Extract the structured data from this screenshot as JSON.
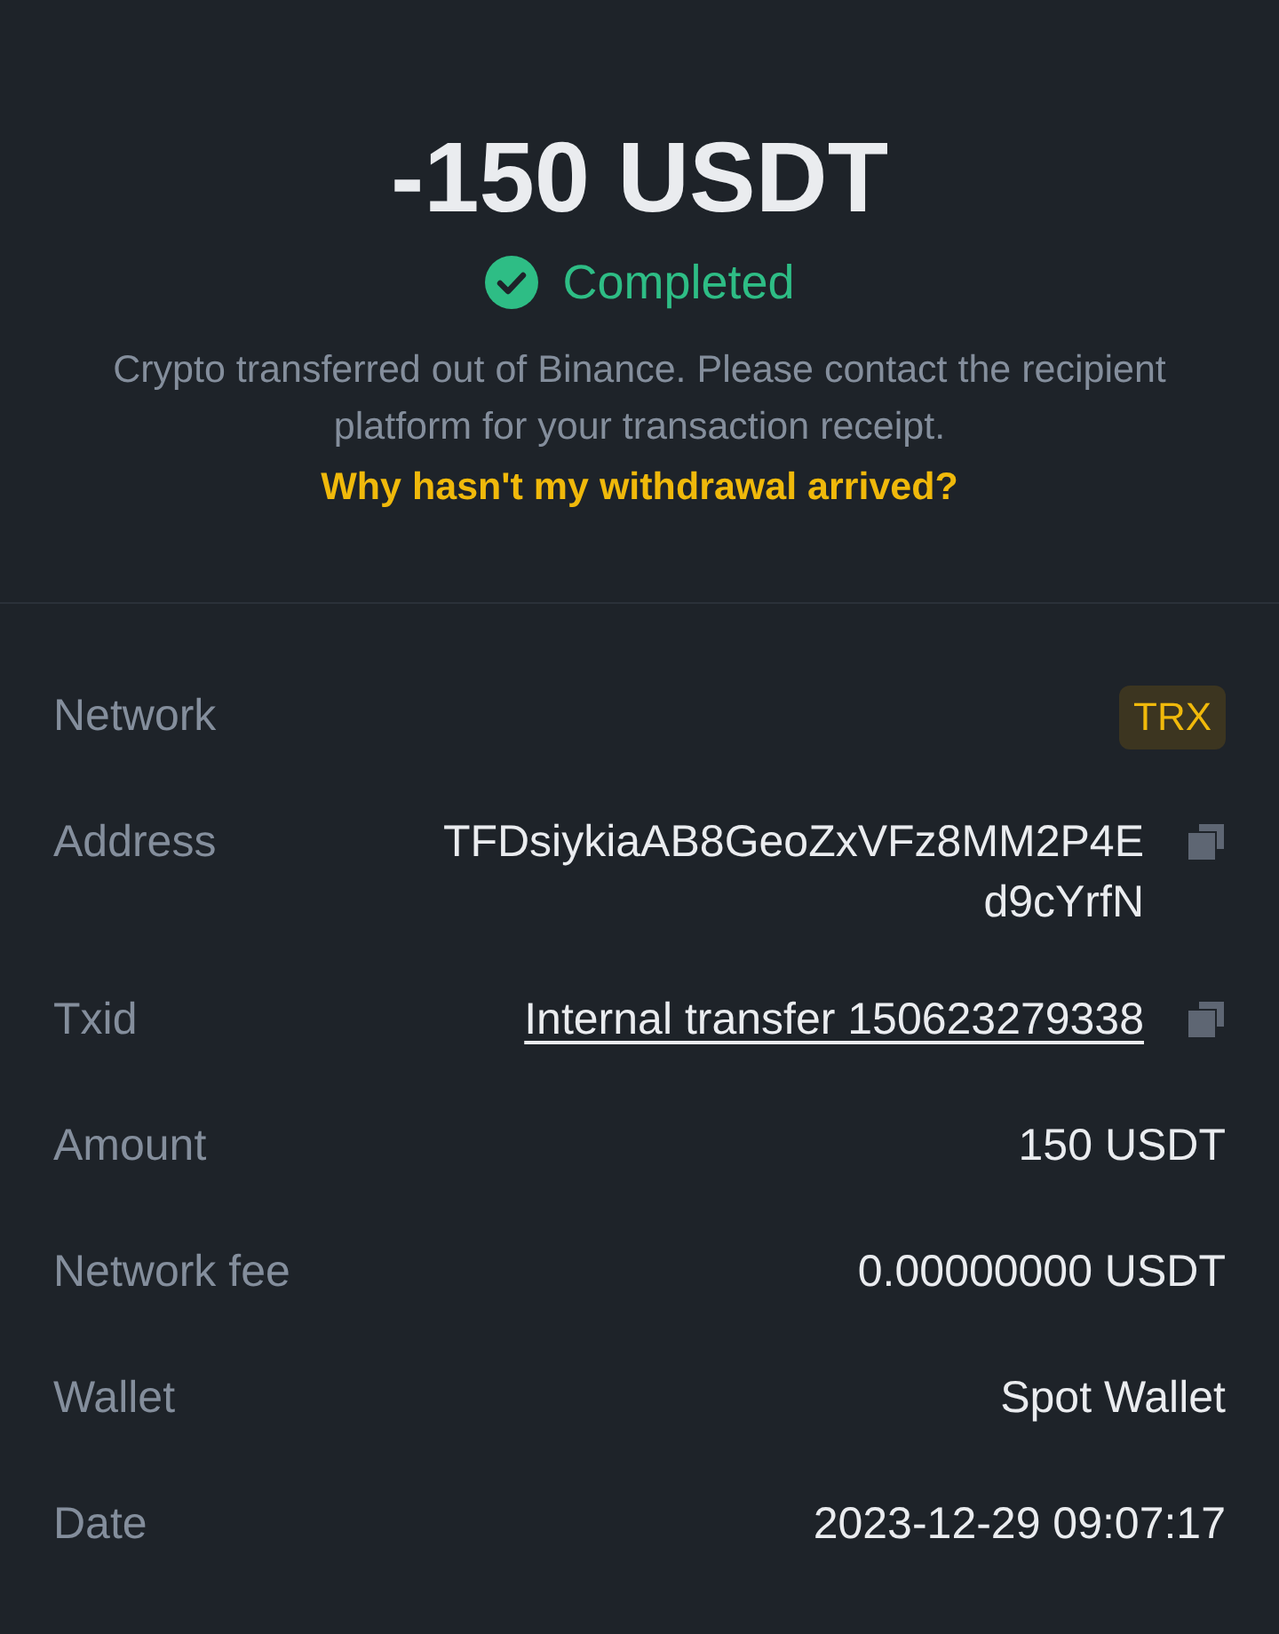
{
  "amount": "-150 USDT",
  "status": {
    "label": "Completed",
    "kind": "success"
  },
  "description": "Crypto transferred out of Binance. Please contact the recipient platform for your transaction receipt.",
  "help_link": "Why hasn't my withdrawal arrived?",
  "details": [
    {
      "label": "Network",
      "value": "TRX",
      "kind": "tag"
    },
    {
      "label": "Address",
      "value": "TFDsiykiaAB8GeoZxVFz8MM2P4Ed9cYrfN",
      "kind": "copy"
    },
    {
      "label": "Txid",
      "value": "Internal transfer 150623279338",
      "kind": "link-copy"
    },
    {
      "label": "Amount",
      "value": "150 USDT",
      "kind": "plain"
    },
    {
      "label": "Network fee",
      "value": "0.00000000 USDT",
      "kind": "plain"
    },
    {
      "label": "Wallet",
      "value": "Spot Wallet",
      "kind": "plain"
    },
    {
      "label": "Date",
      "value": "2023-12-29 09:07:17",
      "kind": "plain"
    }
  ]
}
